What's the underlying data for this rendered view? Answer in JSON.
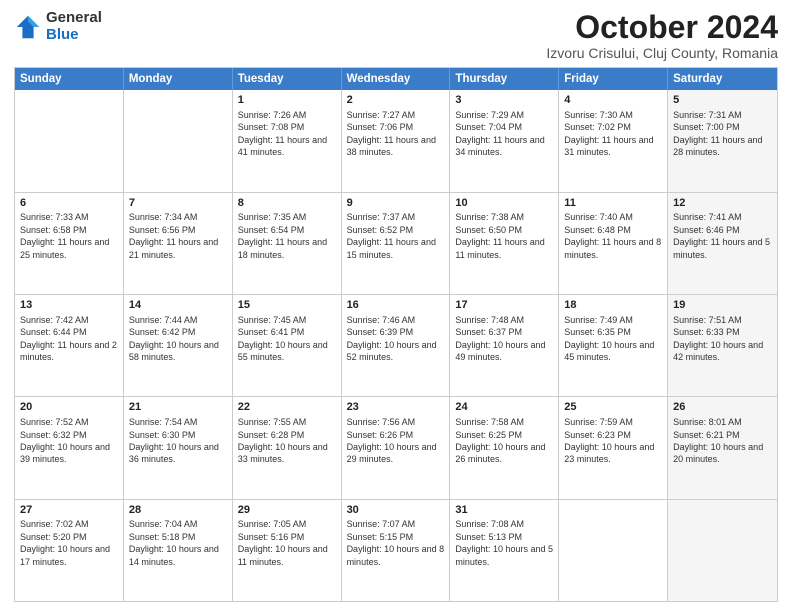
{
  "logo": {
    "general": "General",
    "blue": "Blue"
  },
  "title": "October 2024",
  "location": "Izvoru Crisului, Cluj County, Romania",
  "header_days": [
    "Sunday",
    "Monday",
    "Tuesday",
    "Wednesday",
    "Thursday",
    "Friday",
    "Saturday"
  ],
  "weeks": [
    [
      {
        "day": "",
        "sunrise": "",
        "sunset": "",
        "daylight": "",
        "shaded": false
      },
      {
        "day": "",
        "sunrise": "",
        "sunset": "",
        "daylight": "",
        "shaded": false
      },
      {
        "day": "1",
        "sunrise": "Sunrise: 7:26 AM",
        "sunset": "Sunset: 7:08 PM",
        "daylight": "Daylight: 11 hours and 41 minutes.",
        "shaded": false
      },
      {
        "day": "2",
        "sunrise": "Sunrise: 7:27 AM",
        "sunset": "Sunset: 7:06 PM",
        "daylight": "Daylight: 11 hours and 38 minutes.",
        "shaded": false
      },
      {
        "day": "3",
        "sunrise": "Sunrise: 7:29 AM",
        "sunset": "Sunset: 7:04 PM",
        "daylight": "Daylight: 11 hours and 34 minutes.",
        "shaded": false
      },
      {
        "day": "4",
        "sunrise": "Sunrise: 7:30 AM",
        "sunset": "Sunset: 7:02 PM",
        "daylight": "Daylight: 11 hours and 31 minutes.",
        "shaded": false
      },
      {
        "day": "5",
        "sunrise": "Sunrise: 7:31 AM",
        "sunset": "Sunset: 7:00 PM",
        "daylight": "Daylight: 11 hours and 28 minutes.",
        "shaded": true
      }
    ],
    [
      {
        "day": "6",
        "sunrise": "Sunrise: 7:33 AM",
        "sunset": "Sunset: 6:58 PM",
        "daylight": "Daylight: 11 hours and 25 minutes.",
        "shaded": false
      },
      {
        "day": "7",
        "sunrise": "Sunrise: 7:34 AM",
        "sunset": "Sunset: 6:56 PM",
        "daylight": "Daylight: 11 hours and 21 minutes.",
        "shaded": false
      },
      {
        "day": "8",
        "sunrise": "Sunrise: 7:35 AM",
        "sunset": "Sunset: 6:54 PM",
        "daylight": "Daylight: 11 hours and 18 minutes.",
        "shaded": false
      },
      {
        "day": "9",
        "sunrise": "Sunrise: 7:37 AM",
        "sunset": "Sunset: 6:52 PM",
        "daylight": "Daylight: 11 hours and 15 minutes.",
        "shaded": false
      },
      {
        "day": "10",
        "sunrise": "Sunrise: 7:38 AM",
        "sunset": "Sunset: 6:50 PM",
        "daylight": "Daylight: 11 hours and 11 minutes.",
        "shaded": false
      },
      {
        "day": "11",
        "sunrise": "Sunrise: 7:40 AM",
        "sunset": "Sunset: 6:48 PM",
        "daylight": "Daylight: 11 hours and 8 minutes.",
        "shaded": false
      },
      {
        "day": "12",
        "sunrise": "Sunrise: 7:41 AM",
        "sunset": "Sunset: 6:46 PM",
        "daylight": "Daylight: 11 hours and 5 minutes.",
        "shaded": true
      }
    ],
    [
      {
        "day": "13",
        "sunrise": "Sunrise: 7:42 AM",
        "sunset": "Sunset: 6:44 PM",
        "daylight": "Daylight: 11 hours and 2 minutes.",
        "shaded": false
      },
      {
        "day": "14",
        "sunrise": "Sunrise: 7:44 AM",
        "sunset": "Sunset: 6:42 PM",
        "daylight": "Daylight: 10 hours and 58 minutes.",
        "shaded": false
      },
      {
        "day": "15",
        "sunrise": "Sunrise: 7:45 AM",
        "sunset": "Sunset: 6:41 PM",
        "daylight": "Daylight: 10 hours and 55 minutes.",
        "shaded": false
      },
      {
        "day": "16",
        "sunrise": "Sunrise: 7:46 AM",
        "sunset": "Sunset: 6:39 PM",
        "daylight": "Daylight: 10 hours and 52 minutes.",
        "shaded": false
      },
      {
        "day": "17",
        "sunrise": "Sunrise: 7:48 AM",
        "sunset": "Sunset: 6:37 PM",
        "daylight": "Daylight: 10 hours and 49 minutes.",
        "shaded": false
      },
      {
        "day": "18",
        "sunrise": "Sunrise: 7:49 AM",
        "sunset": "Sunset: 6:35 PM",
        "daylight": "Daylight: 10 hours and 45 minutes.",
        "shaded": false
      },
      {
        "day": "19",
        "sunrise": "Sunrise: 7:51 AM",
        "sunset": "Sunset: 6:33 PM",
        "daylight": "Daylight: 10 hours and 42 minutes.",
        "shaded": true
      }
    ],
    [
      {
        "day": "20",
        "sunrise": "Sunrise: 7:52 AM",
        "sunset": "Sunset: 6:32 PM",
        "daylight": "Daylight: 10 hours and 39 minutes.",
        "shaded": false
      },
      {
        "day": "21",
        "sunrise": "Sunrise: 7:54 AM",
        "sunset": "Sunset: 6:30 PM",
        "daylight": "Daylight: 10 hours and 36 minutes.",
        "shaded": false
      },
      {
        "day": "22",
        "sunrise": "Sunrise: 7:55 AM",
        "sunset": "Sunset: 6:28 PM",
        "daylight": "Daylight: 10 hours and 33 minutes.",
        "shaded": false
      },
      {
        "day": "23",
        "sunrise": "Sunrise: 7:56 AM",
        "sunset": "Sunset: 6:26 PM",
        "daylight": "Daylight: 10 hours and 29 minutes.",
        "shaded": false
      },
      {
        "day": "24",
        "sunrise": "Sunrise: 7:58 AM",
        "sunset": "Sunset: 6:25 PM",
        "daylight": "Daylight: 10 hours and 26 minutes.",
        "shaded": false
      },
      {
        "day": "25",
        "sunrise": "Sunrise: 7:59 AM",
        "sunset": "Sunset: 6:23 PM",
        "daylight": "Daylight: 10 hours and 23 minutes.",
        "shaded": false
      },
      {
        "day": "26",
        "sunrise": "Sunrise: 8:01 AM",
        "sunset": "Sunset: 6:21 PM",
        "daylight": "Daylight: 10 hours and 20 minutes.",
        "shaded": true
      }
    ],
    [
      {
        "day": "27",
        "sunrise": "Sunrise: 7:02 AM",
        "sunset": "Sunset: 5:20 PM",
        "daylight": "Daylight: 10 hours and 17 minutes.",
        "shaded": false
      },
      {
        "day": "28",
        "sunrise": "Sunrise: 7:04 AM",
        "sunset": "Sunset: 5:18 PM",
        "daylight": "Daylight: 10 hours and 14 minutes.",
        "shaded": false
      },
      {
        "day": "29",
        "sunrise": "Sunrise: 7:05 AM",
        "sunset": "Sunset: 5:16 PM",
        "daylight": "Daylight: 10 hours and 11 minutes.",
        "shaded": false
      },
      {
        "day": "30",
        "sunrise": "Sunrise: 7:07 AM",
        "sunset": "Sunset: 5:15 PM",
        "daylight": "Daylight: 10 hours and 8 minutes.",
        "shaded": false
      },
      {
        "day": "31",
        "sunrise": "Sunrise: 7:08 AM",
        "sunset": "Sunset: 5:13 PM",
        "daylight": "Daylight: 10 hours and 5 minutes.",
        "shaded": false
      },
      {
        "day": "",
        "sunrise": "",
        "sunset": "",
        "daylight": "",
        "shaded": false
      },
      {
        "day": "",
        "sunrise": "",
        "sunset": "",
        "daylight": "",
        "shaded": true
      }
    ]
  ]
}
